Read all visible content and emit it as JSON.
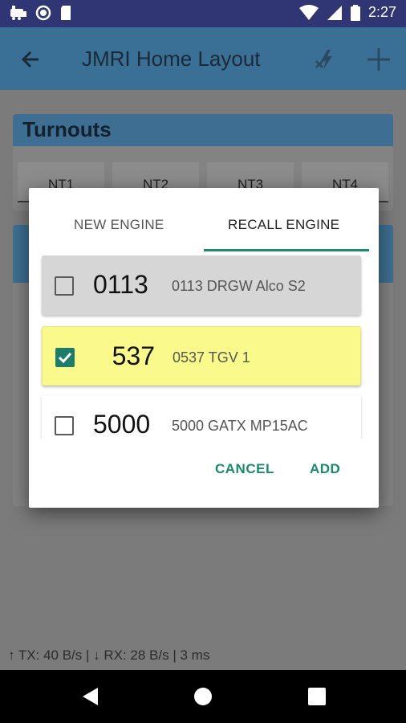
{
  "status_bar": {
    "time": "2:27",
    "left_icons": [
      "train-icon",
      "record-icon",
      "sdcard-icon"
    ],
    "right_icons": [
      "wifi-icon",
      "signal-icon",
      "battery-icon"
    ]
  },
  "app_bar": {
    "title": "JMRI Home Layout",
    "icons": [
      "back-arrow-icon",
      "power-bolt-icon",
      "add-icon"
    ]
  },
  "turnouts": {
    "heading": "Turnouts",
    "buttons": [
      "NT1",
      "NT2",
      "NT3",
      "NT4"
    ]
  },
  "dialog": {
    "tabs": [
      {
        "label": "NEW ENGINE",
        "selected": false
      },
      {
        "label": "RECALL ENGINE",
        "selected": true
      }
    ],
    "engines": [
      {
        "address": "0113",
        "name": "0113 DRGW Alco S2",
        "checked": false,
        "highlight": "gray"
      },
      {
        "address": "537",
        "name": "0537 TGV 1",
        "checked": true,
        "highlight": "yellow"
      },
      {
        "address": "5000",
        "name": "5000 GATX MP15AC",
        "checked": false,
        "highlight": "white"
      }
    ],
    "cancel_label": "CANCEL",
    "add_label": "ADD"
  },
  "traffic": "↑ TX: 40 B/s | ↓ RX: 28 B/s | 3 ms",
  "nav_bar": {
    "icons": [
      "back-triangle-icon",
      "home-circle-icon",
      "recents-square-icon"
    ]
  },
  "colors": {
    "accent": "#1e8a6e",
    "appbar": "#3a6f96",
    "statusbar": "#2f3673",
    "selected_item": "#fafa8c"
  }
}
